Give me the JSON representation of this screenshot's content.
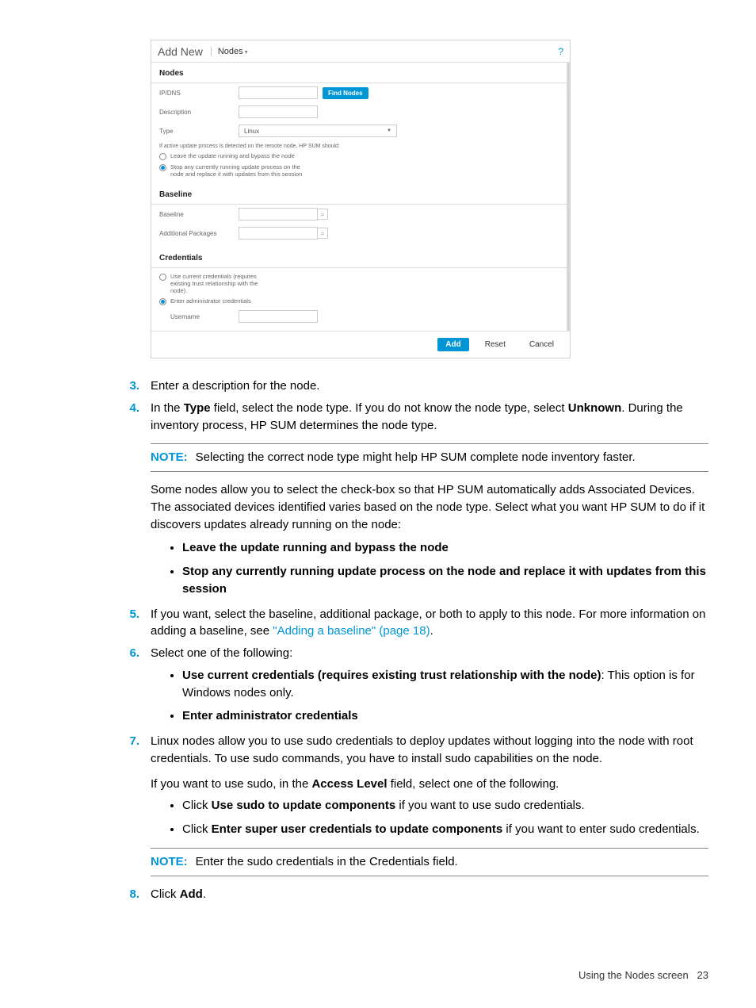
{
  "screenshot": {
    "header": {
      "addnew": "Add New",
      "nodes": "Nodes",
      "help": "?"
    },
    "section_nodes": "Nodes",
    "ipdns_label": "IP/DNS",
    "find_nodes_btn": "Find Nodes",
    "description_label": "Description",
    "type_label": "Type",
    "type_value": "Linux",
    "update_process_help": "If active update process is detected on the remote node, HP SUM should:",
    "radio_leave": "Leave the update running and bypass the node",
    "radio_stop": "Stop any currently running update process on the node and replace it with updates from this session",
    "section_baseline": "Baseline",
    "baseline_label": "Baseline",
    "additional_packages_label": "Additional Packages",
    "section_credentials": "Credentials",
    "cred_radio_current": "Use current credentials (requires existing trust relationship with the node).",
    "cred_radio_enter": "Enter administrator credentials",
    "username_label": "Username",
    "footer": {
      "add": "Add",
      "reset": "Reset",
      "cancel": "Cancel"
    }
  },
  "steps": {
    "s3": {
      "num": "3.",
      "text": "Enter a description for the node."
    },
    "s4": {
      "num": "4.",
      "text_prefix": "In the ",
      "type_bold": "Type",
      "text_mid": " field, select the node type. If you do not know the node type, select ",
      "unknown_bold": "Unknown",
      "text_suffix": ". During the inventory process, HP SUM determines the node type."
    },
    "note1": {
      "label": "NOTE:",
      "text": "Selecting the correct node type might help HP SUM complete node inventory faster."
    },
    "para_associated": "Some nodes allow you to select the check-box so that HP SUM automatically adds Associated Devices. The associated devices identified varies based on the node type. Select what you want HP SUM to do if it discovers updates already running on the node:",
    "bullets_updates": {
      "b1": "Leave the update running and bypass the node",
      "b2": "Stop any currently running update process on the node and replace it with updates from this session"
    },
    "s5": {
      "num": "5.",
      "text_prefix": "If you want, select the baseline, additional package, or both to apply to this node. For more information on adding a baseline, see ",
      "link": "\"Adding a baseline\" (page 18)",
      "text_suffix": "."
    },
    "s6": {
      "num": "6.",
      "text": "Select one of the following:"
    },
    "bullets_creds": {
      "b1_bold": "Use current credentials (requires existing trust relationship with the node)",
      "b1_text": ": This option is for Windows nodes only.",
      "b2_bold": "Enter administrator credentials"
    },
    "s7": {
      "num": "7.",
      "p1": "Linux nodes allow you to use sudo credentials to deploy updates without logging into the node with root credentials. To use sudo commands, you have to install sudo capabilities on the node.",
      "p2_prefix": "If you want to use sudo, in the ",
      "p2_bold": "Access Level",
      "p2_suffix": " field, select one of the following."
    },
    "bullets_sudo": {
      "b1_prefix": "Click ",
      "b1_bold": "Use sudo to update components",
      "b1_suffix": " if you want to use sudo credentials.",
      "b2_prefix": "Click ",
      "b2_bold": "Enter super user credentials to update components",
      "b2_suffix": " if you want to enter sudo credentials."
    },
    "note2": {
      "label": "NOTE:",
      "text": "Enter the sudo credentials in the Credentials field."
    },
    "s8": {
      "num": "8.",
      "text_prefix": "Click ",
      "add_bold": "Add",
      "text_suffix": "."
    }
  },
  "footer": {
    "text": "Using the Nodes screen",
    "page": "23"
  }
}
